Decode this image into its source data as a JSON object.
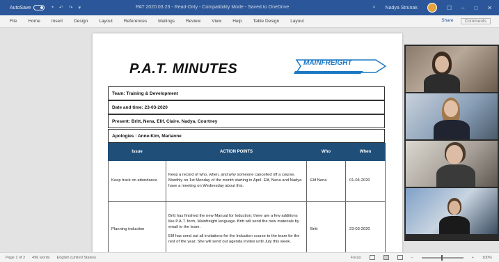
{
  "titlebar": {
    "autosave_label": "AutoSave",
    "toggle_state": "On",
    "document_title": "PAT 2020.03.23 - Read-Only - Compatibility Mode - Saved to OneDrive",
    "search_label": "Search",
    "user_name": "Nadya Strunak"
  },
  "menubar": {
    "items": [
      "File",
      "Home",
      "Insert",
      "Design",
      "Layout",
      "References",
      "Mailings",
      "Review",
      "View",
      "Help",
      "Table Design",
      "Layout"
    ],
    "share_label": "Share",
    "comments_label": "Comments"
  },
  "document": {
    "title": "P.A.T. MINUTES",
    "logo_text": "MAINFREIGHT",
    "team": "Team: Training & Development",
    "date_time": "Date and time: 23-03-2020",
    "present": "Present: Britt, Nena, Elif, Claire, Nadya, Courtney",
    "apologies": "Apologies : Anne-Kim, Marianne",
    "table": {
      "headers": [
        "Issue",
        "ACTION POINTS",
        "Who",
        "When"
      ],
      "rows": [
        {
          "issue": "Keep track on attendance",
          "action_lines": [
            "Keep a record of who, when, and why someone cancelled off a course. Monthly on 1st Monday of the month starting in April. Elif, Nena and Nadya have a meeting on Wednesday about this."
          ],
          "who": "Elif Nena",
          "when": "01-04-2020"
        },
        {
          "issue": "Planning induction",
          "action_lines": [
            "Britt has finished the new Manual for Induction; there are a few additions like P.A.T. form, Mainfreight language. Britt will send the new materials by email to the team.",
            "Elif has send out all invitations for the Induction course to the team for the rest of the year. She will send out agenda invites until July this week."
          ],
          "who": "Britt",
          "when": "23-03-2020"
        }
      ]
    }
  },
  "statusbar": {
    "page": "Page 1 of 2",
    "words": "496 words",
    "language": "English (United States)",
    "focus": "Focus",
    "zoom": "100%"
  }
}
